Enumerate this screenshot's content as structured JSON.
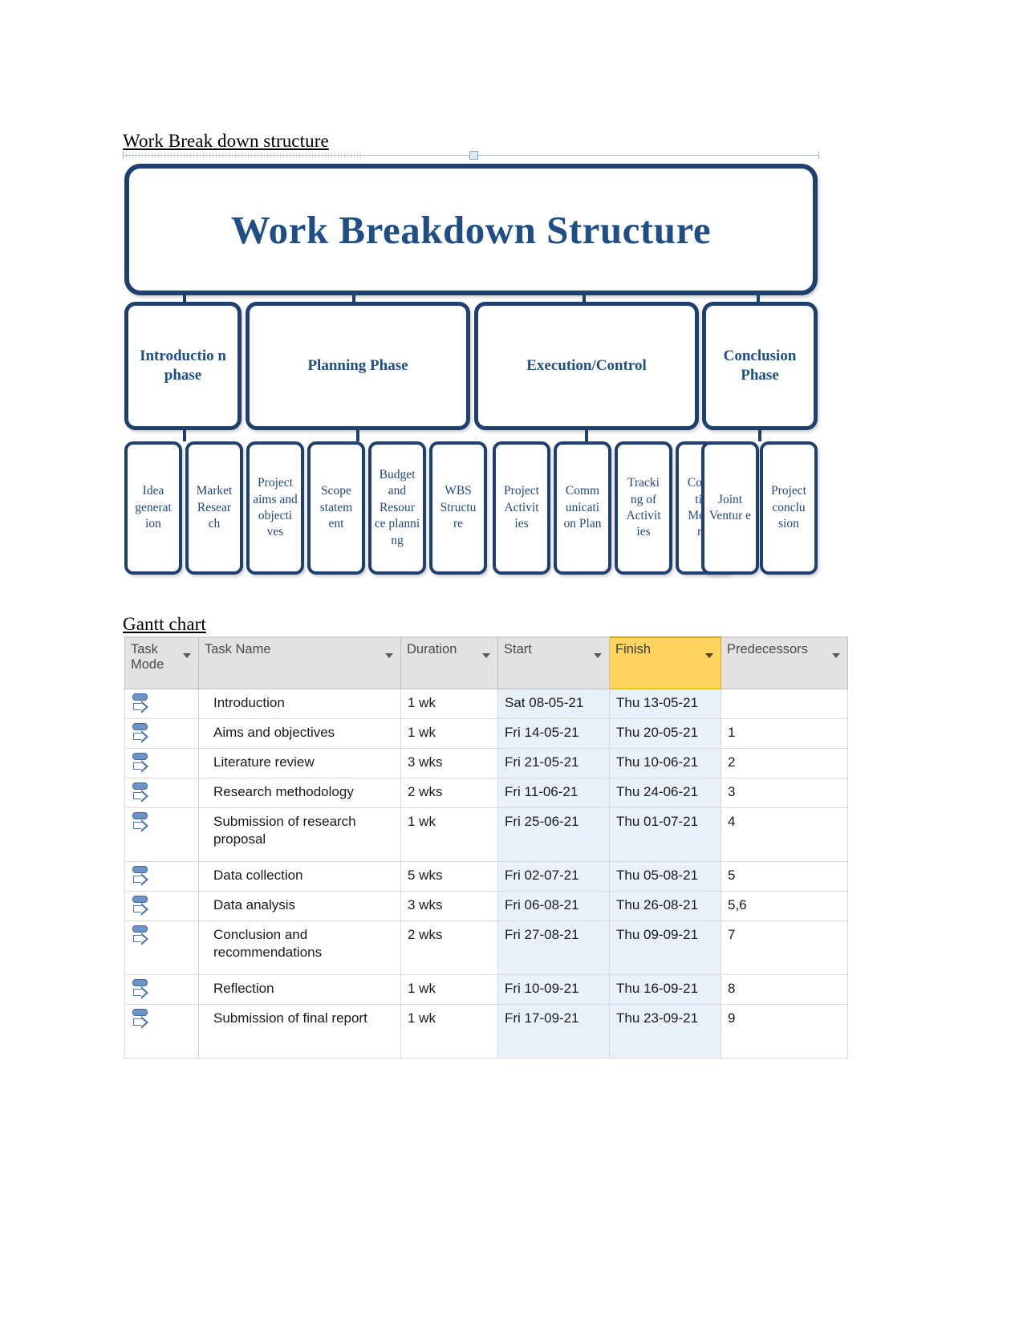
{
  "document": {
    "wbs_heading": "Work Break down structure ",
    "gantt_heading": "Gantt chart"
  },
  "wbs": {
    "root_title": "Work Breakdown Structure",
    "phases": [
      {
        "label": "Introductio n phase"
      },
      {
        "label": "Planning Phase"
      },
      {
        "label": "Execution/Control"
      },
      {
        "label": "Conclusion Phase"
      }
    ],
    "leaves": [
      {
        "label": "Idea generat ion"
      },
      {
        "label": "Market Resear ch"
      },
      {
        "label": "Project aims and objecti ves"
      },
      {
        "label": "Scope statem ent"
      },
      {
        "label": "Budget and Resour ce planni ng"
      },
      {
        "label": "WBS Structu re"
      },
      {
        "label": "Project Activit ies"
      },
      {
        "label": "Comm unicati on Plan"
      },
      {
        "label": "Tracki ng of Activit ies"
      },
      {
        "label": "Correc tive Measu res"
      },
      {
        "label": "Joint Ventur e"
      },
      {
        "label": "Project conclu sion"
      }
    ],
    "accent_border_color": "#1f3f6e",
    "text_color": "#1f4e87"
  },
  "gantt": {
    "columns": [
      {
        "label": "Task Mode",
        "highlighted": false
      },
      {
        "label": "Task Name",
        "highlighted": false
      },
      {
        "label": "Duration",
        "highlighted": false
      },
      {
        "label": "Start",
        "highlighted": false
      },
      {
        "label": "Finish",
        "highlighted": true
      },
      {
        "label": "Predecessors",
        "highlighted": false
      }
    ],
    "highlight_color": "#ffd45e",
    "date_column_fill": "#e8f0fa",
    "task_mode_icon": "manually-scheduled-icon",
    "rows": [
      {
        "mode": "manually-scheduled-icon",
        "name": "Introduction",
        "duration": "1 wk",
        "start": "Sat 08-05-21",
        "finish": "Thu 13-05-21",
        "predecessors": ""
      },
      {
        "mode": "manually-scheduled-icon",
        "name": "Aims and objectives",
        "duration": "1 wk",
        "start": "Fri 14-05-21",
        "finish": "Thu 20-05-21",
        "predecessors": "1"
      },
      {
        "mode": "manually-scheduled-icon",
        "name": "Literature review",
        "duration": "3 wks",
        "start": "Fri 21-05-21",
        "finish": "Thu 10-06-21",
        "predecessors": "2"
      },
      {
        "mode": "manually-scheduled-icon",
        "name": "Research methodology",
        "duration": "2 wks",
        "start": "Fri 11-06-21",
        "finish": "Thu 24-06-21",
        "predecessors": "3"
      },
      {
        "mode": "manually-scheduled-icon",
        "name": "Submission of research proposal",
        "duration": "1 wk",
        "start": "Fri 25-06-21",
        "finish": "Thu 01-07-21",
        "predecessors": "4"
      },
      {
        "mode": "manually-scheduled-icon",
        "name": "Data collection",
        "duration": "5 wks",
        "start": "Fri 02-07-21",
        "finish": "Thu 05-08-21",
        "predecessors": "5"
      },
      {
        "mode": "manually-scheduled-icon",
        "name": "Data analysis",
        "duration": "3 wks",
        "start": "Fri 06-08-21",
        "finish": "Thu 26-08-21",
        "predecessors": "5,6"
      },
      {
        "mode": "manually-scheduled-icon",
        "name": "Conclusion and recommendations",
        "duration": "2 wks",
        "start": "Fri 27-08-21",
        "finish": "Thu 09-09-21",
        "predecessors": "7"
      },
      {
        "mode": "manually-scheduled-icon",
        "name": "Reflection",
        "duration": "1 wk",
        "start": "Fri 10-09-21",
        "finish": "Thu 16-09-21",
        "predecessors": "8"
      },
      {
        "mode": "manually-scheduled-icon",
        "name": "Submission of final report",
        "duration": "1 wk",
        "start": "Fri 17-09-21",
        "finish": "Thu 23-09-21",
        "predecessors": "9"
      }
    ]
  }
}
